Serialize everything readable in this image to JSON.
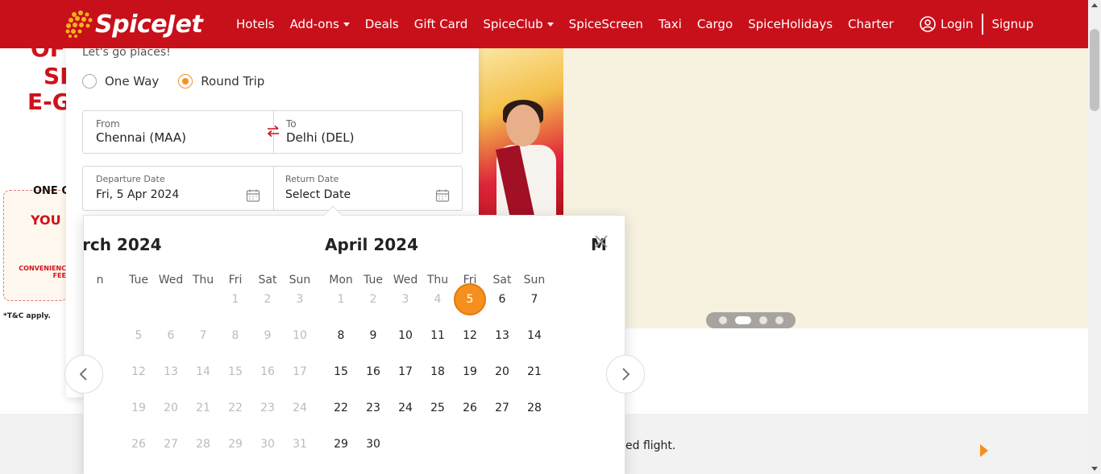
{
  "header": {
    "brand": "SpiceJet",
    "nav": [
      {
        "label": "Hotels",
        "dropdown": false
      },
      {
        "label": "Add-ons",
        "dropdown": true
      },
      {
        "label": "Deals",
        "dropdown": false
      },
      {
        "label": "Gift Card",
        "dropdown": false
      },
      {
        "label": "SpiceClub",
        "dropdown": true
      },
      {
        "label": "SpiceScreen",
        "dropdown": false
      },
      {
        "label": "Taxi",
        "dropdown": false
      },
      {
        "label": "Cargo",
        "dropdown": false
      },
      {
        "label": "SpiceHolidays",
        "dropdown": false
      },
      {
        "label": "Charter",
        "dropdown": false
      }
    ],
    "login": "Login",
    "signup": "Signup"
  },
  "banner": {
    "promo_lines": [
      "OF",
      "SP",
      "E-G"
    ],
    "one_c": "ONE C",
    "you": "YOU",
    "convenience": "CONVENIENC FEE",
    "tc": "*T&C apply."
  },
  "booking": {
    "tagline": "Let's go places!",
    "trip_types": [
      {
        "label": "One Way",
        "checked": false
      },
      {
        "label": "Round Trip",
        "checked": true
      }
    ],
    "from_label": "From",
    "from_value": "Chennai (MAA)",
    "to_label": "To",
    "to_value": "Delhi (DEL)",
    "departure_label": "Departure Date",
    "departure_value": "Fri, 5 Apr 2024",
    "return_label": "Return Date",
    "return_value": "Select Date"
  },
  "calendar": {
    "left_month": "rch 2024",
    "right_month": "April 2024",
    "next_month_peek": "M",
    "left_dow": [
      "n",
      "Tue",
      "Wed",
      "Thu",
      "Fri",
      "Sat",
      "Sun"
    ],
    "right_dow": [
      "Mon",
      "Tue",
      "Wed",
      "Thu",
      "Fri",
      "Sat",
      "Sun"
    ],
    "left_weeks": [
      [
        "",
        "",
        "",
        "",
        "1",
        "2",
        "3"
      ],
      [
        "",
        "5",
        "6",
        "7",
        "8",
        "9",
        "10"
      ],
      [
        "",
        "12",
        "13",
        "14",
        "15",
        "16",
        "17"
      ],
      [
        "",
        "19",
        "20",
        "21",
        "22",
        "23",
        "24"
      ],
      [
        "",
        "26",
        "27",
        "28",
        "29",
        "30",
        "31"
      ]
    ],
    "right_weeks": [
      [
        "1",
        "2",
        "3",
        "4",
        "5",
        "6",
        "7"
      ],
      [
        "8",
        "9",
        "10",
        "11",
        "12",
        "13",
        "14"
      ],
      [
        "15",
        "16",
        "17",
        "18",
        "19",
        "20",
        "21"
      ],
      [
        "22",
        "23",
        "24",
        "25",
        "26",
        "27",
        "28"
      ],
      [
        "29",
        "30",
        "",
        "",
        "",
        "",
        ""
      ]
    ],
    "right_muted_days": [
      "1",
      "2",
      "3",
      "4"
    ],
    "selected_day": "5"
  },
  "strip": {
    "text": "ed flight."
  },
  "colors": {
    "brand_red": "#c8101a",
    "accent_orange": "#f5901e"
  }
}
